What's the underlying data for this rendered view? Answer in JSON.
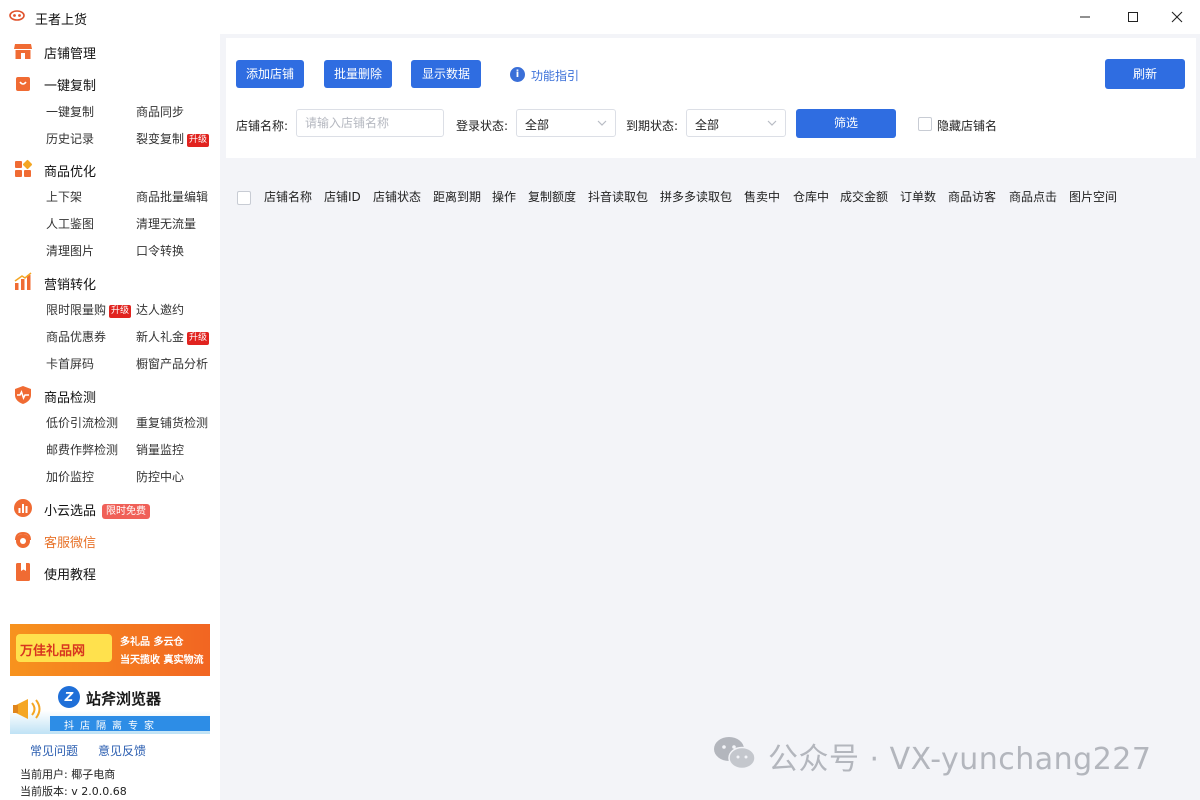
{
  "window": {
    "title": "王者上货"
  },
  "sidebar": {
    "sections": [
      {
        "label": "店铺管理"
      },
      {
        "label": "一键复制",
        "items": [
          "一键复制",
          "商品同步",
          "历史记录",
          "裂变复制"
        ]
      },
      {
        "label": "商品优化",
        "items": [
          "上下架",
          "商品批量编辑",
          "人工鉴图",
          "清理无流量",
          "清理图片",
          "口令转换"
        ]
      },
      {
        "label": "营销转化",
        "items": [
          "限时限量购",
          "达人邀约",
          "商品优惠券",
          "新人礼金",
          "卡首屏码",
          "橱窗产品分析"
        ]
      },
      {
        "label": "商品检测",
        "items": [
          "低价引流检测",
          "重复铺货检测",
          "邮费作弊检测",
          "销量监控",
          "加价监控",
          "防控中心"
        ]
      },
      {
        "label": "小云选品",
        "badge": "限时免费"
      },
      {
        "label": "客服微信"
      },
      {
        "label": "使用教程"
      }
    ],
    "upgrade_badge": "升级",
    "banners": {
      "wanjia": {
        "name": "万佳礼品网",
        "line1": "多礼品 多云仓",
        "line2": "当天揽收 真实物流"
      },
      "zhanfu": {
        "logo": "Z",
        "name": "站斧浏览器",
        "slogan": "抖店隔离专家"
      }
    },
    "footer": {
      "faq": "常见问题",
      "feedback": "意见反馈",
      "user": "当前用户: 椰子电商",
      "version": "当前版本: v 2.0.0.68"
    }
  },
  "toolbar": {
    "add_store": "添加店铺",
    "batch_delete": "批量删除",
    "show_data": "显示数据",
    "guide": "功能指引",
    "refresh": "刷新"
  },
  "filters": {
    "store_name_label": "店铺名称:",
    "store_name_placeholder": "请输入店铺名称",
    "store_name_value": "",
    "login_status_label": "登录状态:",
    "login_status_value": "全部",
    "expire_status_label": "到期状态:",
    "expire_status_value": "全部",
    "filter_button": "筛选",
    "hide_store_name": "隐藏店铺名"
  },
  "table": {
    "columns": [
      "店铺名称",
      "店铺ID",
      "店铺状态",
      "距离到期",
      "操作",
      "复制额度",
      "抖音读取包",
      "拼多多读取包",
      "售卖中",
      "仓库中",
      "成交金额",
      "订单数",
      "商品访客",
      "商品点击",
      "图片空间"
    ],
    "rows": []
  },
  "watermark": "公众号 · VX-yunchang227",
  "colors": {
    "primary": "#2f6de1",
    "badge_red": "#e1231f",
    "wechat_orange": "#e8732a",
    "background": "#f3f4f8"
  }
}
